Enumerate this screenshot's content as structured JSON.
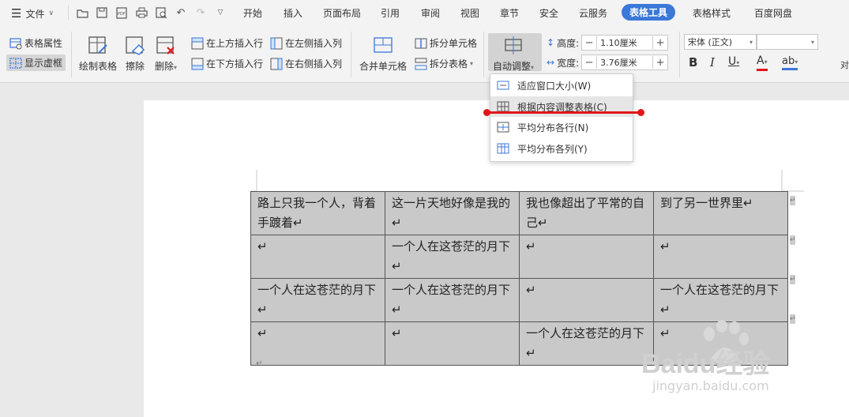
{
  "menubar": {
    "file_label": "文件",
    "tabs": [
      {
        "label": "开始"
      },
      {
        "label": "插入"
      },
      {
        "label": "页面布局"
      },
      {
        "label": "引用"
      },
      {
        "label": "审阅"
      },
      {
        "label": "视图"
      },
      {
        "label": "章节"
      },
      {
        "label": "安全"
      },
      {
        "label": "云服务"
      },
      {
        "label": "表格工具",
        "active": true
      },
      {
        "label": "表格样式"
      },
      {
        "label": "百度网盘"
      }
    ]
  },
  "ribbon": {
    "table_props": "表格属性",
    "show_gridlines": "显示虚框",
    "draw_table": "绘制表格",
    "erase": "擦除",
    "delete": "删除",
    "insert_above": "在上方插入行",
    "insert_below": "在下方插入行",
    "insert_left": "在左侧插入列",
    "insert_right": "在右侧插入列",
    "merge_cells": "合并单元格",
    "split_cells": "拆分单元格",
    "split_table": "拆分表格",
    "auto_fit": "自动调整",
    "height_label": "高度:",
    "height_value": "1.10厘米",
    "width_label": "宽度:",
    "width_value": "3.76厘米",
    "font_name": "宋体 (正文)",
    "align_label": "对"
  },
  "dropdown": {
    "items": [
      {
        "label": "适应窗口大小(W)"
      },
      {
        "label": "根据内容调整表格(C)"
      },
      {
        "label": "平均分布各行(N)"
      },
      {
        "label": "平均分布各列(Y)"
      }
    ]
  },
  "table": {
    "rows": [
      [
        "路上只我一个人，背着手踱着↵",
        "这一片天地好像是我的↵",
        "我也像超出了平常的自己↵",
        "到了另一世界里↵"
      ],
      [
        "↵",
        "一个人在这苍茫的月下↵",
        "↵",
        "↵"
      ],
      [
        "一个人在这苍茫的月下↵",
        "一个人在这苍茫的月下↵",
        "↵",
        "一个人在这苍茫的月下↵"
      ],
      [
        "↵",
        "↵",
        "一个人在这苍茫的月下↵",
        "↵"
      ]
    ],
    "after_table": "↵"
  },
  "watermark": {
    "brand": "Baidu经验",
    "url": "jingyan.baidu.com"
  },
  "colors": {
    "accent": "#3a78d9",
    "highlight_line": "#e0161b",
    "cell_bg": "#c9c9c9"
  }
}
